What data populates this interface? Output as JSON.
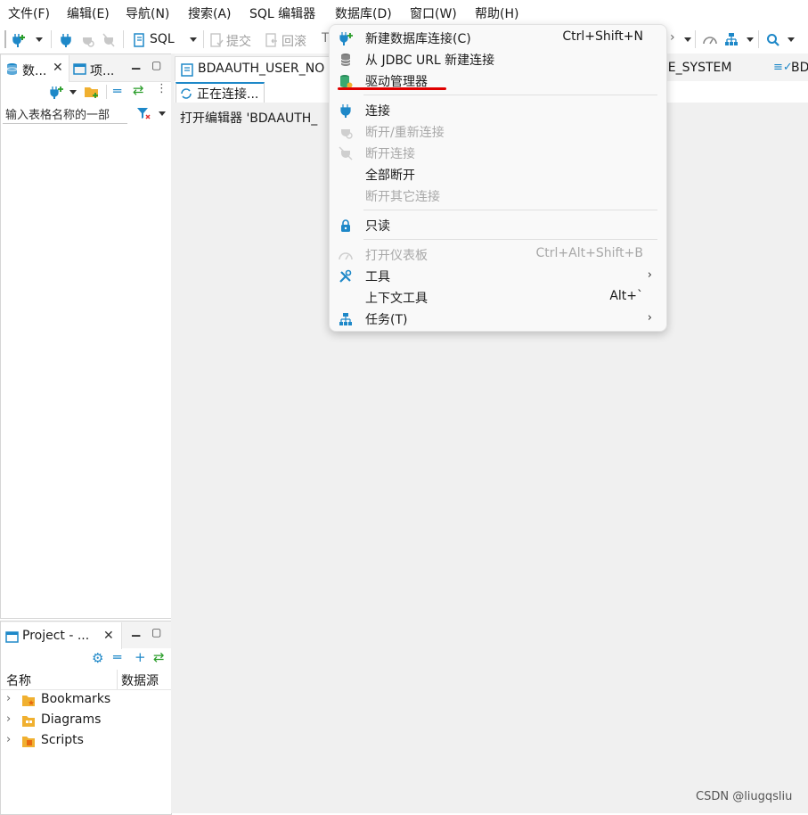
{
  "menubar": {
    "items": [
      "文件(F)",
      "编辑(E)",
      "导航(N)",
      "搜索(A)",
      "SQL 编辑器",
      "数据库(D)",
      "窗口(W)",
      "帮助(H)"
    ]
  },
  "toolbar": {
    "sql_label": "SQL",
    "commit_label": "提交",
    "rollback_label": "回滚"
  },
  "nav_panel": {
    "tabs": [
      "数...",
      "项..."
    ],
    "filter_placeholder": "输入表格名称的一部"
  },
  "project_panel": {
    "title": "Project - ...",
    "columns": [
      "名称",
      "数据源"
    ],
    "items": [
      "Bookmarks",
      "Diagrams",
      "Scripts"
    ]
  },
  "editor": {
    "tabs": [
      "BDAAUTH_USER_NO",
      "RCE_SYSTEM",
      "BD"
    ],
    "subtab": "正在连接...",
    "status_text": "打开编辑器 'BDAAUTH_"
  },
  "database_menu": {
    "items": [
      {
        "label": "新建数据库连接(C)",
        "shortcut": "Ctrl+Shift+N",
        "icon": "new-connection-icon",
        "enabled": true
      },
      {
        "label": "从 JDBC URL 新建连接",
        "shortcut": "",
        "icon": "database-stack-icon",
        "enabled": true
      },
      {
        "label": "驱动管理器",
        "shortcut": "",
        "icon": "driver-manager-icon",
        "enabled": true
      },
      {
        "label": "连接",
        "shortcut": "",
        "icon": "plug-icon",
        "enabled": true
      },
      {
        "label": "断开/重新连接",
        "shortcut": "",
        "icon": "reconnect-icon",
        "enabled": false
      },
      {
        "label": "断开连接",
        "shortcut": "",
        "icon": "disconnect-icon",
        "enabled": false
      },
      {
        "label": "全部断开",
        "shortcut": "",
        "icon": "",
        "enabled": true
      },
      {
        "label": "断开其它连接",
        "shortcut": "",
        "icon": "",
        "enabled": false
      },
      {
        "label": "只读",
        "shortcut": "",
        "icon": "lock-icon",
        "enabled": true
      },
      {
        "label": "打开仪表板",
        "shortcut": "Ctrl+Alt+Shift+B",
        "icon": "dashboard-icon",
        "enabled": false
      },
      {
        "label": "工具",
        "shortcut": "",
        "icon": "tools-icon",
        "enabled": true,
        "submenu": true
      },
      {
        "label": "上下文工具",
        "shortcut": "Alt+`",
        "icon": "",
        "enabled": true
      },
      {
        "label": "任务(T)",
        "shortcut": "",
        "icon": "tasks-icon",
        "enabled": true,
        "submenu": true
      }
    ],
    "highlight_color": "#e00000"
  },
  "watermark": "CSDN @liugqsliu",
  "colors": {
    "accent": "#1e88c8",
    "disabled": "#a8a8a8",
    "menu_bg": "#f9f9f9"
  }
}
